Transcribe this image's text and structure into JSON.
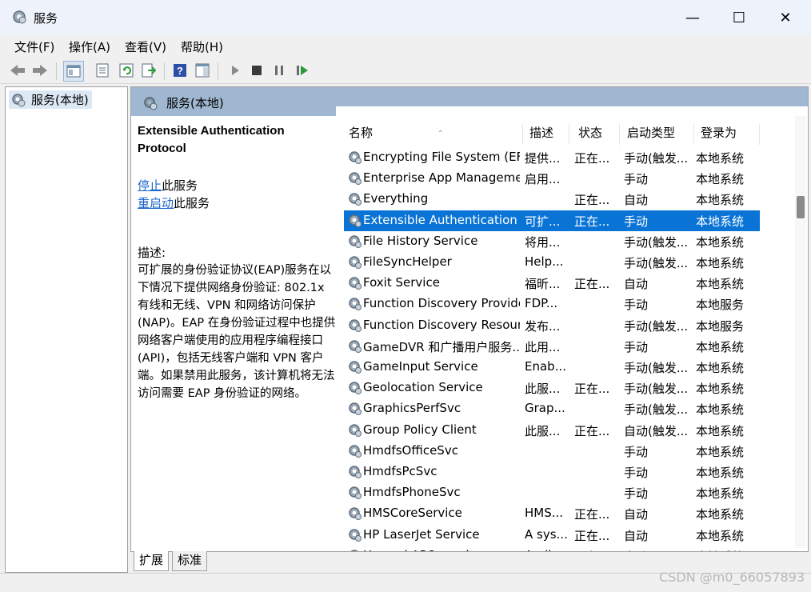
{
  "window": {
    "title": "服务",
    "minimize_glyph": "—",
    "maximize_glyph": "☐",
    "close_glyph": "✕"
  },
  "menu": [
    "文件(F)",
    "操作(A)",
    "查看(V)",
    "帮助(H)"
  ],
  "tree": {
    "root_label": "服务(本地)"
  },
  "main": {
    "header_title": "服务(本地)",
    "selected_service_name": "Extensible Authentication Protocol",
    "stop_link": "停止",
    "stop_suffix": "此服务",
    "restart_link": "重启动",
    "restart_suffix": "此服务",
    "description_label": "描述:",
    "description_text": "可扩展的身份验证协议(EAP)服务在以下情况下提供网络身份验证: 802.1x 有线和无线、VPN 和网络访问保护(NAP)。EAP 在身份验证过程中也提供网络客户端使用的应用程序编程接口(API)，包括无线客户端和 VPN 客户端。如果禁用此服务，该计算机将无法访问需要 EAP 身份验证的网络。"
  },
  "columns": [
    "名称",
    "描述",
    "状态",
    "启动类型",
    "登录为"
  ],
  "services": [
    {
      "name": "Encrypting File System (EFS)",
      "desc": "提供...",
      "status": "正在...",
      "startup": "手动(触发...",
      "logon": "本地系统"
    },
    {
      "name": "Enterprise App Manageme...",
      "desc": "启用...",
      "status": "",
      "startup": "手动",
      "logon": "本地系统"
    },
    {
      "name": "Everything",
      "desc": "",
      "status": "正在...",
      "startup": "自动",
      "logon": "本地系统"
    },
    {
      "name": "Extensible Authentication ...",
      "desc": "可扩...",
      "status": "正在...",
      "startup": "手动",
      "logon": "本地系统",
      "selected": true
    },
    {
      "name": "File History Service",
      "desc": "将用...",
      "status": "",
      "startup": "手动(触发...",
      "logon": "本地系统"
    },
    {
      "name": "FileSyncHelper",
      "desc": "Help...",
      "status": "",
      "startup": "手动(触发...",
      "logon": "本地系统"
    },
    {
      "name": "Foxit Service",
      "desc": "福昕...",
      "status": "正在...",
      "startup": "自动",
      "logon": "本地系统"
    },
    {
      "name": "Function Discovery Provide...",
      "desc": "FDP...",
      "status": "",
      "startup": "手动",
      "logon": "本地服务"
    },
    {
      "name": "Function Discovery Resour...",
      "desc": "发布...",
      "status": "",
      "startup": "手动(触发...",
      "logon": "本地服务"
    },
    {
      "name": "GameDVR 和广播用户服务...",
      "desc": "此用...",
      "status": "",
      "startup": "手动",
      "logon": "本地系统"
    },
    {
      "name": "GameInput Service",
      "desc": "Enab...",
      "status": "",
      "startup": "手动(触发...",
      "logon": "本地系统"
    },
    {
      "name": "Geolocation Service",
      "desc": "此服...",
      "status": "正在...",
      "startup": "手动(触发...",
      "logon": "本地系统"
    },
    {
      "name": "GraphicsPerfSvc",
      "desc": "Grap...",
      "status": "",
      "startup": "手动(触发...",
      "logon": "本地系统"
    },
    {
      "name": "Group Policy Client",
      "desc": "此服...",
      "status": "正在...",
      "startup": "自动(触发...",
      "logon": "本地系统"
    },
    {
      "name": "HmdfsOfficeSvc",
      "desc": "",
      "status": "",
      "startup": "手动",
      "logon": "本地系统"
    },
    {
      "name": "HmdfsPcSvc",
      "desc": "",
      "status": "",
      "startup": "手动",
      "logon": "本地系统"
    },
    {
      "name": "HmdfsPhoneSvc",
      "desc": "",
      "status": "",
      "startup": "手动",
      "logon": "本地系统"
    },
    {
      "name": "HMSCoreService",
      "desc": "HMS...",
      "status": "正在...",
      "startup": "自动",
      "logon": "本地系统"
    },
    {
      "name": "HP LaserJet Service",
      "desc": "A sys...",
      "status": "正在...",
      "startup": "自动",
      "logon": "本地系统"
    },
    {
      "name": "Huawei APO service",
      "desc": "Audi...",
      "status": "正在...",
      "startup": "自动",
      "logon": "本地系统"
    }
  ],
  "tabs": [
    "扩展",
    "标准"
  ],
  "watermark": "CSDN @m0_66057893",
  "colors": {
    "selection": "#0a74d6",
    "header_band": "#9fb7d0",
    "link": "#1a64c8"
  }
}
